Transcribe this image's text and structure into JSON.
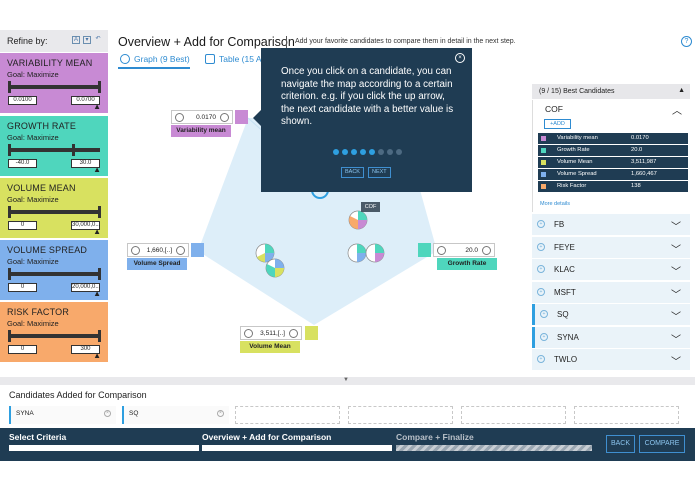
{
  "sidebar": {
    "refine_label": "Refine by:",
    "criteria": [
      {
        "name": "VARIABILITY MEAN",
        "goal": "Goal: Maximize",
        "min": "0.0100",
        "max": "0.0700",
        "color": "#c88ad4"
      },
      {
        "name": "GROWTH RATE",
        "goal": "Goal: Maximize",
        "min": "-40.0",
        "max": "30.0",
        "color": "#4fd6bd"
      },
      {
        "name": "VOLUME MEAN",
        "goal": "Goal: Maximize",
        "min": "0",
        "max": "30,000,0...",
        "color": "#d8e160"
      },
      {
        "name": "VOLUME SPREAD",
        "goal": "Goal: Maximize",
        "min": "0",
        "max": "20,000,0...",
        "color": "#7fb0ec"
      },
      {
        "name": "RISK FACTOR",
        "goal": "Goal: Maximize",
        "min": "0",
        "max": "300",
        "color": "#f8a96b"
      }
    ]
  },
  "header": {
    "title": "Overview + Add for Comparison",
    "hint": "Add your favorite candidates to compare them in detail in the next step.",
    "help": "?"
  },
  "tabs": {
    "graph": "Graph (9 Best)",
    "table": "Table (15 All"
  },
  "graph": {
    "axes": [
      {
        "value": "0.0170",
        "label": "Variability mean"
      },
      {
        "value": "20.0",
        "label": "Growth Rate"
      },
      {
        "value": "3,511,[..]",
        "label": "Volume Mean"
      },
      {
        "value": "1,660,[..]",
        "label": "Volume Spread"
      }
    ],
    "tooltip_label": "COF"
  },
  "popover": {
    "message": "Once you click on a candidate, you can navigate the map according to a certain criterion. e.g. if you click the up arrow, the next candidate with a better value is shown.",
    "back": "BACK",
    "next": "NEXT",
    "close": "×",
    "step": 5,
    "total_steps": 8
  },
  "right_panel": {
    "header": "(9 / 15) Best Candidates",
    "active": {
      "name": "COF",
      "add": "ADD",
      "rows": [
        {
          "label": "Variability mean",
          "value": "0.0170",
          "color": "#c88ad4"
        },
        {
          "label": "Growth Rate",
          "value": "20.0",
          "color": "#4fd6bd"
        },
        {
          "label": "Volume Mean",
          "value": "3,511,987",
          "color": "#d8e160"
        },
        {
          "label": "Volume Spread",
          "value": "1,660,467",
          "color": "#7fb0ec"
        },
        {
          "label": "Risk Factor",
          "value": "138",
          "color": "#f8a96b"
        }
      ],
      "more": "More details"
    },
    "candidates": [
      "FB",
      "FEYE",
      "KLAC",
      "MSFT",
      "SQ",
      "SYNA",
      "TWLO"
    ]
  },
  "tray": {
    "title": "Candidates Added for Comparison",
    "added": [
      "SYNA",
      "SQ"
    ]
  },
  "wizard": {
    "steps": [
      "Select Criteria",
      "Overview + Add for Comparison",
      "Compare + Finalize"
    ],
    "back": "BACK",
    "compare": "COMPARE"
  }
}
